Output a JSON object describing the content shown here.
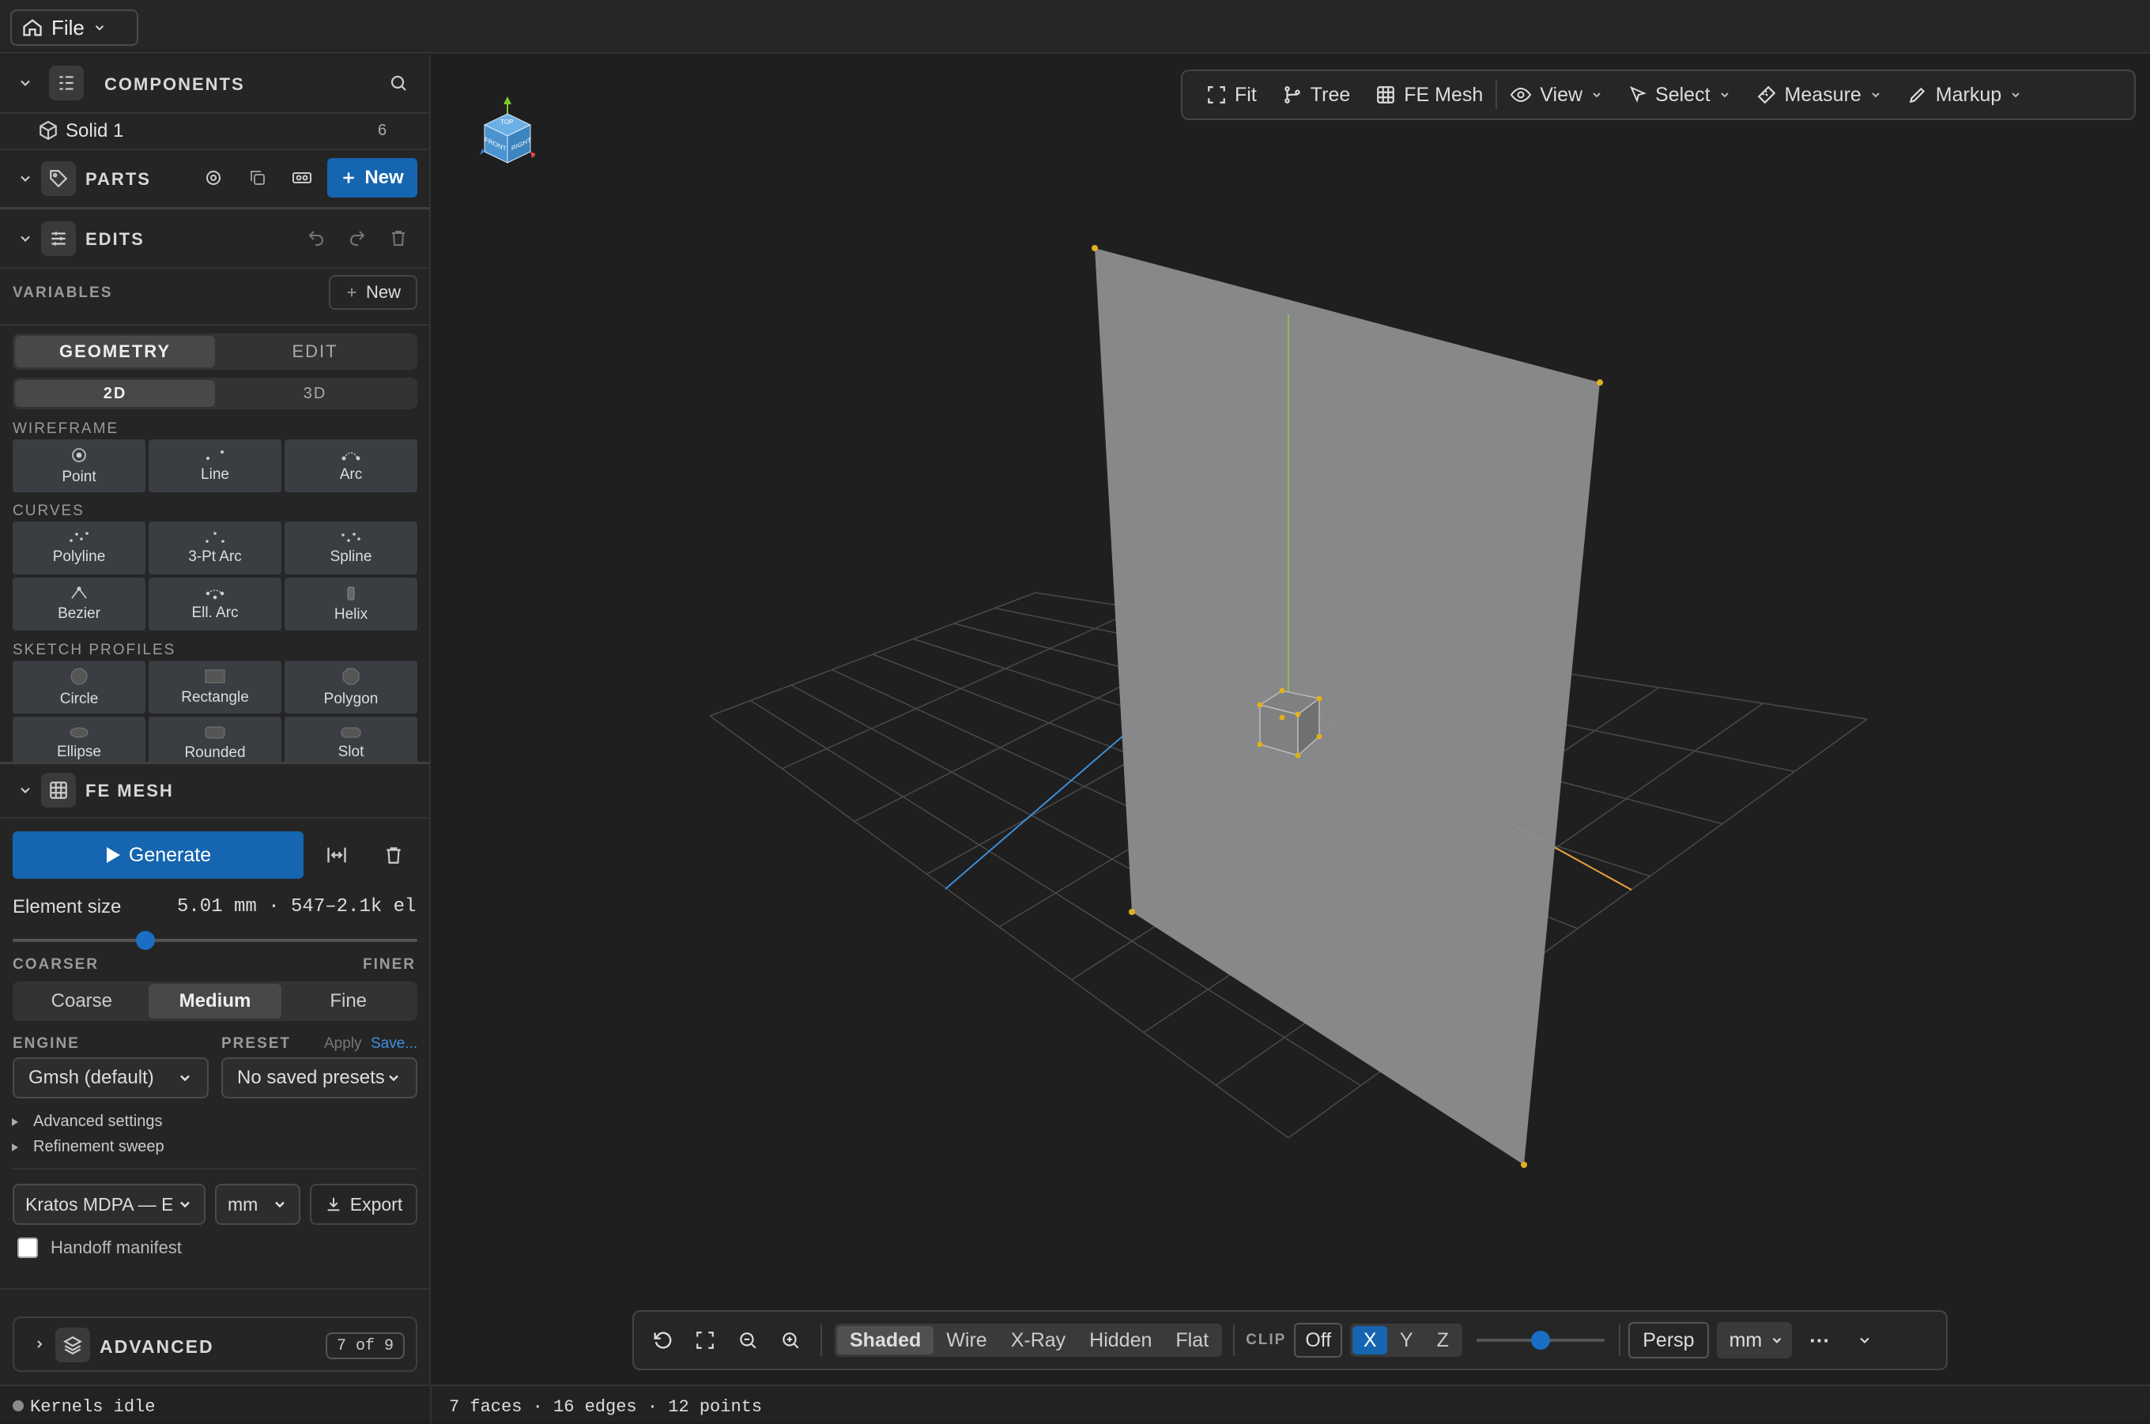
{
  "topbar": {
    "file_label": "File"
  },
  "components": {
    "title": "COMPONENTS",
    "items": [
      {
        "label": "Solid 1",
        "count": "6"
      }
    ]
  },
  "parts": {
    "title": "PARTS",
    "new_label": "New"
  },
  "edits": {
    "title": "EDITS"
  },
  "variables": {
    "title": "VARIABLES",
    "new_label": "New"
  },
  "geometry": {
    "mode_tabs": [
      "GEOMETRY",
      "EDIT"
    ],
    "dim_tabs": [
      "2D",
      "3D"
    ],
    "groups": [
      {
        "label": "WIREFRAME",
        "tools": [
          "Point",
          "Line",
          "Arc"
        ]
      },
      {
        "label": "CURVES",
        "tools": [
          "Polyline",
          "3-Pt Arc",
          "Spline",
          "Bezier",
          "Ell. Arc",
          "Helix"
        ]
      },
      {
        "label": "SKETCH PROFILES",
        "tools": [
          "Circle",
          "Rectangle",
          "Polygon",
          "Ellipse",
          "Rounded",
          "Slot"
        ]
      }
    ]
  },
  "fe_mesh": {
    "title": "FE MESH",
    "generate_label": "Generate",
    "element_size_label": "Element size",
    "element_size_value": "5.01 mm · 547–2.1k el",
    "slider_fraction": 0.32,
    "coarser_label": "COARSER",
    "finer_label": "FINER",
    "density": [
      "Coarse",
      "Medium",
      "Fine"
    ],
    "engine_label": "ENGINE",
    "preset_label": "PRESET",
    "apply_label": "Apply",
    "save_label": "Save...",
    "engine_value": "Gmsh (default)",
    "preset_value": "No saved presets",
    "advanced_settings": "Advanced settings",
    "refinement_sweep": "Refinement sweep",
    "export_format": "Kratos MDPA — El",
    "export_unit": "mm",
    "export_label": "Export",
    "handoff_label": "Handoff manifest"
  },
  "advanced": {
    "title": "ADVANCED",
    "badge": "7 of 9"
  },
  "toolbar": {
    "fit": "Fit",
    "tree": "Tree",
    "fe_mesh": "FE Mesh",
    "view": "View",
    "select": "Select",
    "measure": "Measure",
    "markup": "Markup"
  },
  "bottombar": {
    "render_modes": [
      "Shaded",
      "Wire",
      "X-Ray",
      "Hidden",
      "Flat"
    ],
    "clip_label": "CLIP",
    "clip_off": "Off",
    "axes": [
      "X",
      "Y",
      "Z"
    ],
    "clip_fraction": 0.5,
    "projection": "Persp",
    "unit": "mm",
    "more": "···"
  },
  "viewcube": {
    "top": "TOP",
    "front": "FRONT",
    "right": "RIGHT"
  },
  "status": {
    "kernel": "Kernels idle",
    "stats": "7 faces · 16 edges · 12 points"
  },
  "colors": {
    "accent": "#1565b0",
    "x_axis": "#e8a33d",
    "y_axis": "#9bc53d",
    "z_axis": "#3a8fd6",
    "surface": "#8a8b8d"
  }
}
